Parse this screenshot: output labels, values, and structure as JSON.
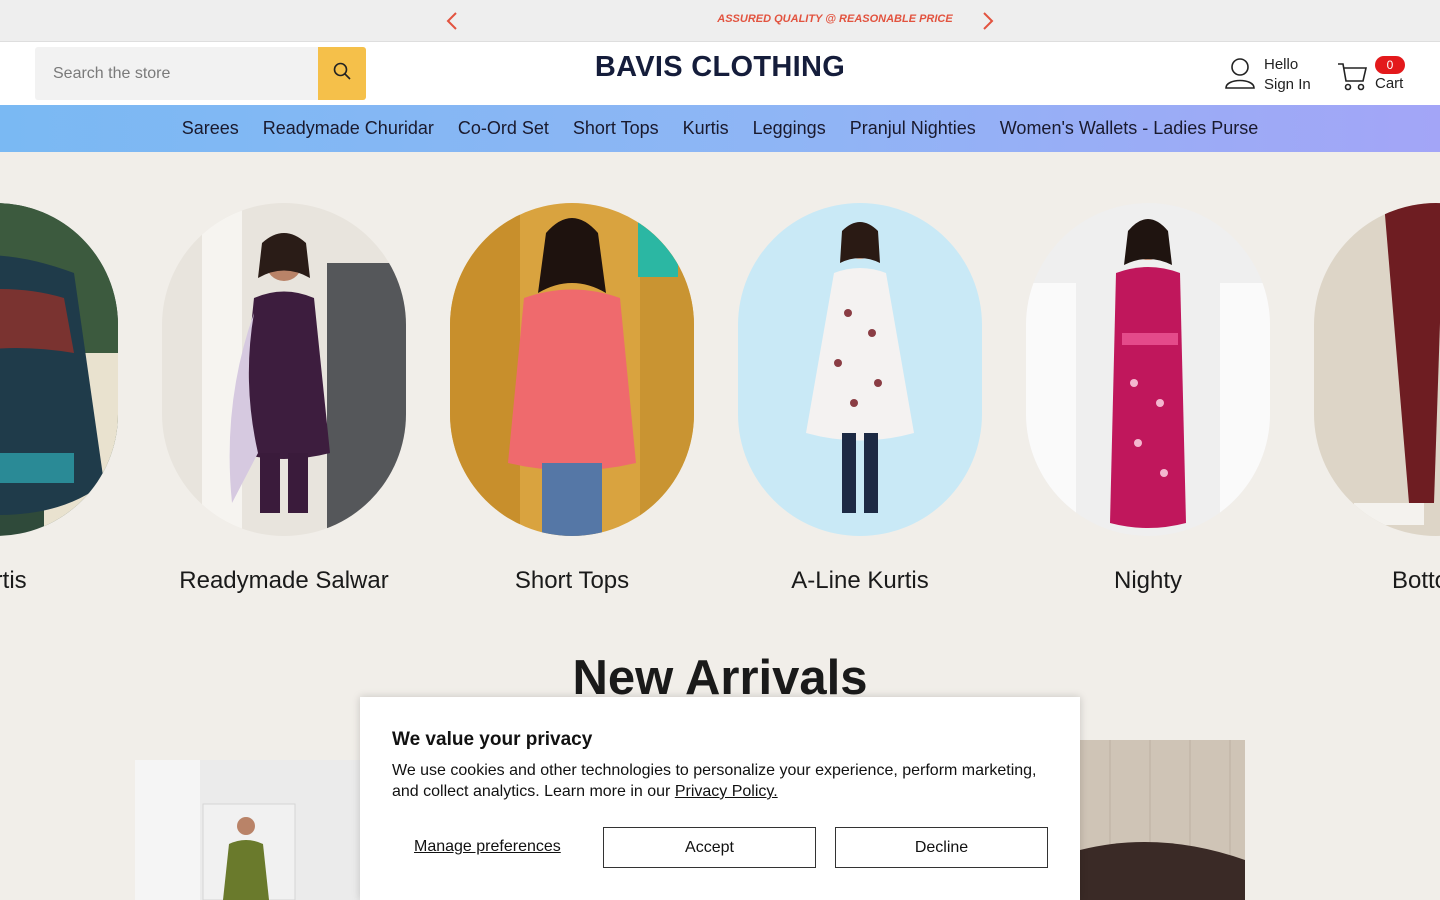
{
  "announcement": {
    "message": "ASSURED QUALITY @ REASONABLE PRICE",
    "prev_icon": "chevron-left-icon",
    "next_icon": "chevron-right-icon",
    "color": "#e2533f"
  },
  "header": {
    "search_placeholder": "Search the store",
    "search_icon": "search-icon",
    "logo": "BAVIS CLOTHING",
    "account": {
      "line1": "Hello",
      "line2": "Sign In",
      "icon": "user-icon"
    },
    "cart": {
      "label": "Cart",
      "count": "0",
      "icon": "cart-icon"
    }
  },
  "nav": {
    "items": [
      "Sarees",
      "Readymade Churidar",
      "Co-Ord Set",
      "Short Tops",
      "Kurtis",
      "Leggings",
      "Pranjul Nighties",
      "Women's Wallets - Ladies Purse"
    ]
  },
  "collections": [
    {
      "label": "Kurtis"
    },
    {
      "label": "Readymade Salwar"
    },
    {
      "label": "Short Tops"
    },
    {
      "label": "A-Line Kurtis"
    },
    {
      "label": "Nighty"
    },
    {
      "label": "Bottoms"
    }
  ],
  "arrivals": {
    "title": "New Arrivals"
  },
  "cookie": {
    "title": "We value your privacy",
    "body": "We use cookies and other technologies to personalize your experience, perform marketing, and collect analytics. Learn more in our ",
    "link": "Privacy Policy.",
    "manage": "Manage preferences",
    "accept": "Accept",
    "decline": "Decline"
  },
  "colors": {
    "search_button": "#f5c04a",
    "cart_badge": "#e3191b",
    "logo": "#151d3b"
  }
}
